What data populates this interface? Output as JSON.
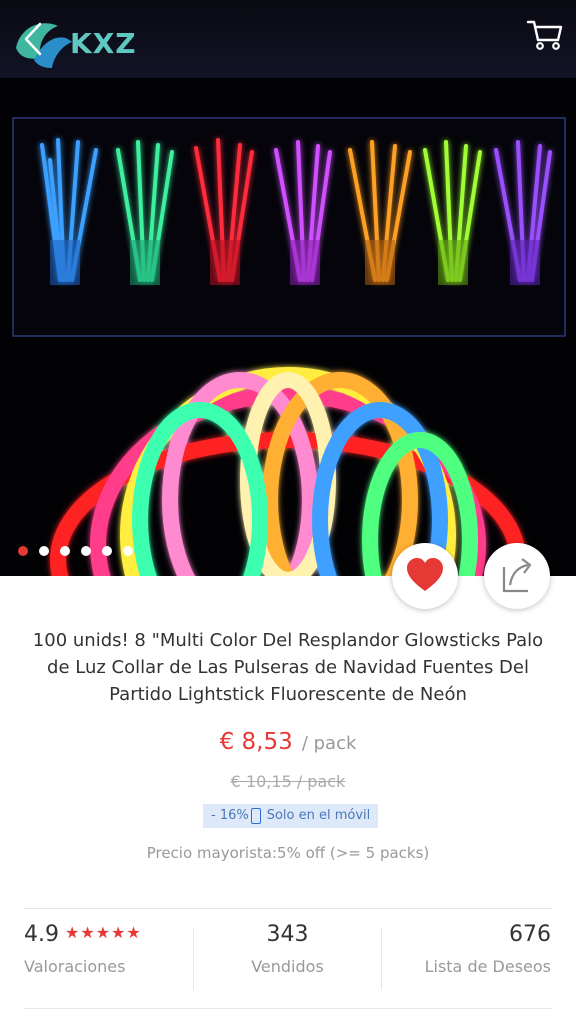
{
  "header": {
    "logo_text": "KXZ",
    "back_icon": "chevron-left-icon",
    "cart_icon": "cart-icon"
  },
  "gallery": {
    "total_images": 6,
    "active_index": 0
  },
  "product": {
    "title": "100 unids! 8 \"Multi Color Del Resplandor Glowsticks Palo de Luz Collar de Las Pulseras de Navidad Fuentes Del Partido Lightstick Fluorescente de Neón",
    "price": "€ 8,53",
    "price_unit": "/ pack",
    "old_price": "€ 10,15 / pack",
    "discount": "- 16%",
    "mobile_only": "Solo en el móvil",
    "wholesale": "Precio mayorista:5% off (>= 5 packs)"
  },
  "stats": {
    "rating": "4.9",
    "stars": "★★★★★",
    "rating_label": "Valoraciones",
    "sold": "343",
    "sold_label": "Vendidos",
    "wishlist": "676",
    "wishlist_label": "Lista de Deseos"
  },
  "colors": {
    "accent": "#e53935",
    "promo_bg": "#dde9f8",
    "promo_text": "#4b77b8"
  }
}
